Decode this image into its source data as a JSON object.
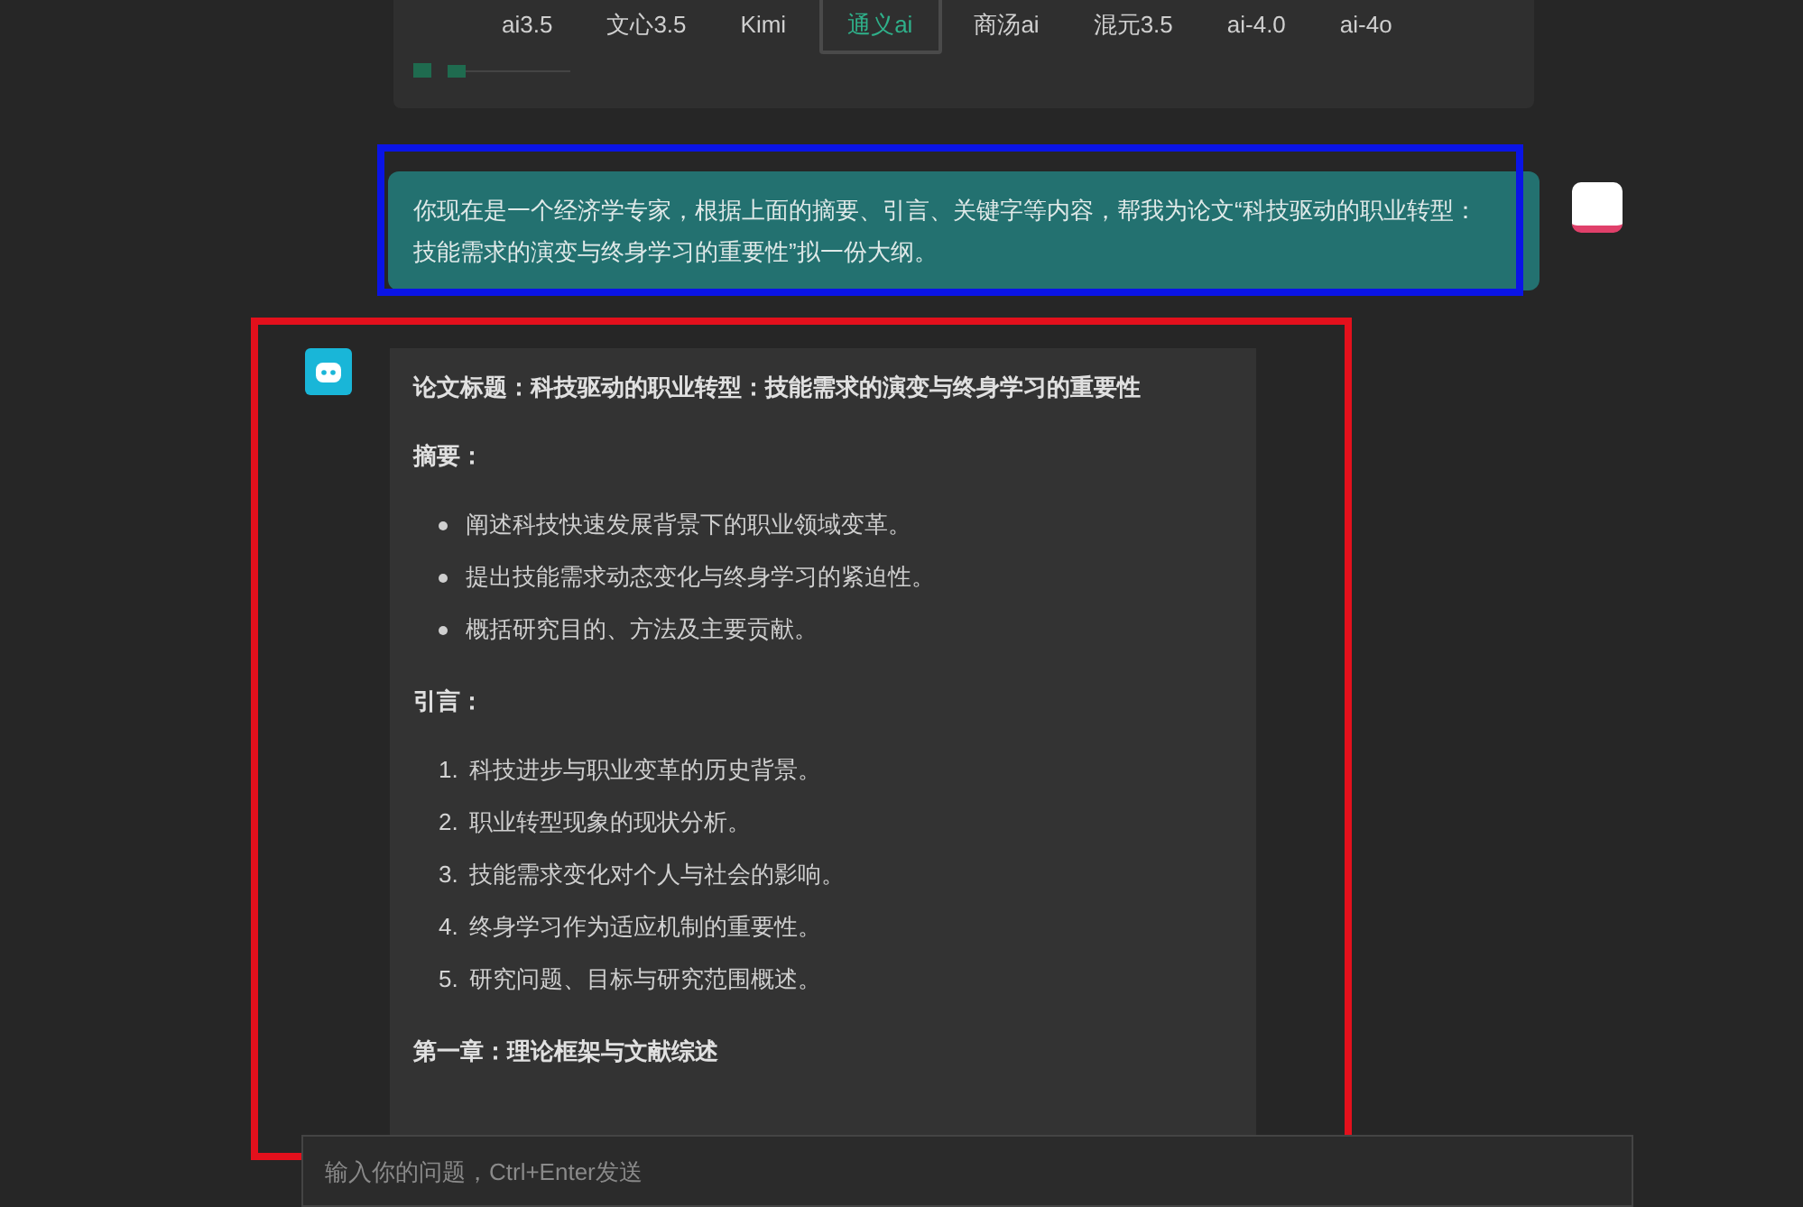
{
  "previous_reply": {
    "model_tabs": [
      {
        "label": "ai3.5",
        "selected": false
      },
      {
        "label": "文心3.5",
        "selected": false
      },
      {
        "label": "Kimi",
        "selected": false
      },
      {
        "label": "通义ai",
        "selected": true
      },
      {
        "label": "商汤ai",
        "selected": false
      },
      {
        "label": "混元3.5",
        "selected": false
      },
      {
        "label": "ai-4.0",
        "selected": false
      },
      {
        "label": "ai-4o",
        "selected": false
      }
    ]
  },
  "user_message": {
    "text": "你现在是一个经济学专家，根据上面的摘要、引言、关键字等内容，帮我为论文“科技驱动的职业转型：技能需求的演变与终身学习的重要性”拟一份大纲。"
  },
  "answer": {
    "blocks": [
      {
        "kind": "heading",
        "text": "论文标题：科技驱动的职业转型：技能需求的演变与终身学习的重要性"
      },
      {
        "kind": "heading",
        "text": "摘要："
      },
      {
        "kind": "bullets",
        "items": [
          "阐述科技快速发展背景下的职业领域变革。",
          "提出技能需求动态变化与终身学习的紧迫性。",
          "概括研究目的、方法及主要贡献。"
        ]
      },
      {
        "kind": "heading",
        "text": "引言："
      },
      {
        "kind": "numbered",
        "items": [
          {
            "number": "1.",
            "text": "科技进步与职业变革的历史背景。"
          },
          {
            "number": "2.",
            "text": "职业转型现象的现状分析。"
          },
          {
            "number": "3.",
            "text": "技能需求变化对个人与社会的影响。"
          },
          {
            "number": "4.",
            "text": "终身学习作为适应机制的重要性。"
          },
          {
            "number": "5.",
            "text": "研究问题、目标与研究范围概述。"
          }
        ]
      },
      {
        "kind": "heading",
        "text": "第一章：理论框架与文献综述"
      }
    ]
  },
  "input": {
    "placeholder": "输入你的问题，Ctrl+Enter发送"
  }
}
